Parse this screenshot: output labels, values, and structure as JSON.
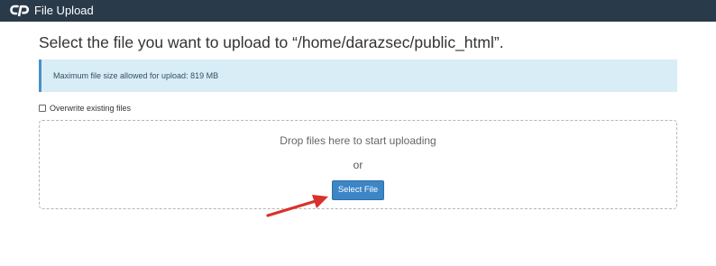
{
  "header": {
    "title": "File Upload",
    "logo_icon": "cpanel-logo-icon",
    "background": "#293a4a"
  },
  "main": {
    "heading": "Select the file you want to upload to “/home/darazsec/public_html”.",
    "info_message": "Maximum file size allowed for upload: 819 MB",
    "overwrite_label": "Overwrite existing files",
    "overwrite_checked": false,
    "drop_text": "Drop files here to start uploading",
    "or_text": "or",
    "select_button_label": "Select File"
  },
  "colors": {
    "info_background": "#d9edf7",
    "info_border": "#4a90c8",
    "button_background": "#3c85c6",
    "annotation_arrow": "#d9312b"
  },
  "annotation": {
    "arrow_icon": "red-arrow-icon"
  }
}
